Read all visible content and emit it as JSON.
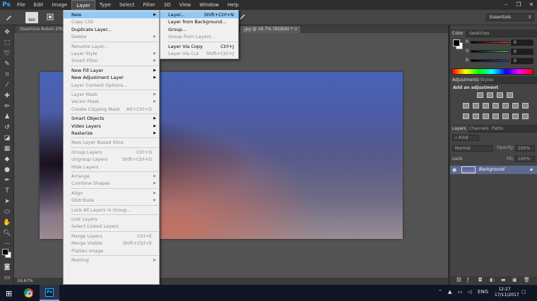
{
  "app": {
    "logo": "Ps"
  },
  "menubar": [
    "File",
    "Edit",
    "Image",
    "Layer",
    "Type",
    "Select",
    "Filter",
    "3D",
    "View",
    "Window",
    "Help"
  ],
  "window_controls": {
    "minimize": "–",
    "restore": "❐",
    "close": "✕"
  },
  "options": {
    "brush_size": "990",
    "workspace": "Essentials"
  },
  "tabs": [
    {
      "label": "Steelnine Bokeh Effe"
    },
    {
      "label": ".jpg @ 16.7% (RGB/8) *"
    }
  ],
  "status": {
    "zoom": "16.67%"
  },
  "layer_menu": [
    {
      "label": "New",
      "arrow": true,
      "highlight": true
    },
    {
      "label": "Copy CSS",
      "disabled": true
    },
    {
      "label": "Duplicate Layer..."
    },
    {
      "label": "Delete",
      "arrow": true,
      "disabled": true
    },
    {
      "sep": true
    },
    {
      "label": "Rename Layer...",
      "disabled": true
    },
    {
      "label": "Layer Style",
      "arrow": true,
      "disabled": true
    },
    {
      "label": "Smart Filter",
      "arrow": true,
      "disabled": true
    },
    {
      "sep": true
    },
    {
      "label": "New Fill Layer",
      "arrow": true
    },
    {
      "label": "New Adjustment Layer",
      "arrow": true
    },
    {
      "label": "Layer Content Options...",
      "disabled": true
    },
    {
      "sep": true
    },
    {
      "label": "Layer Mask",
      "arrow": true,
      "disabled": true
    },
    {
      "label": "Vector Mask",
      "arrow": true,
      "disabled": true
    },
    {
      "label": "Create Clipping Mask",
      "shortcut": "Alt+Ctrl+G",
      "disabled": true
    },
    {
      "sep": true
    },
    {
      "label": "Smart Objects",
      "arrow": true
    },
    {
      "label": "Video Layers",
      "arrow": true
    },
    {
      "label": "Rasterize",
      "arrow": true
    },
    {
      "sep": true
    },
    {
      "label": "New Layer Based Slice",
      "disabled": true
    },
    {
      "sep": true
    },
    {
      "label": "Group Layers",
      "shortcut": "Ctrl+G",
      "disabled": true
    },
    {
      "label": "Ungroup Layers",
      "shortcut": "Shift+Ctrl+G",
      "disabled": true
    },
    {
      "label": "Hide Layers",
      "disabled": true
    },
    {
      "sep": true
    },
    {
      "label": "Arrange",
      "arrow": true,
      "disabled": true
    },
    {
      "label": "Combine Shapes",
      "arrow": true,
      "disabled": true
    },
    {
      "sep": true
    },
    {
      "label": "Align",
      "arrow": true,
      "disabled": true
    },
    {
      "label": "Distribute",
      "arrow": true,
      "disabled": true
    },
    {
      "sep": true
    },
    {
      "label": "Lock All Layers in Group...",
      "disabled": true
    },
    {
      "sep": true
    },
    {
      "label": "Link Layers",
      "disabled": true
    },
    {
      "label": "Select Linked Layers",
      "disabled": true
    },
    {
      "sep": true
    },
    {
      "label": "Merge Layers",
      "shortcut": "Ctrl+E",
      "disabled": true
    },
    {
      "label": "Merge Visible",
      "shortcut": "Shift+Ctrl+E",
      "disabled": true
    },
    {
      "label": "Flatten Image",
      "disabled": true
    },
    {
      "sep": true
    },
    {
      "label": "Matting",
      "arrow": true,
      "disabled": true
    }
  ],
  "new_submenu": [
    {
      "label": "Layer...",
      "shortcut": "Shift+Ctrl+N",
      "highlight": true
    },
    {
      "label": "Layer from Background..."
    },
    {
      "label": "Group..."
    },
    {
      "label": "Group from Layers...",
      "disabled": true
    },
    {
      "sep": true
    },
    {
      "label": "Layer Via Copy",
      "shortcut": "Ctrl+J"
    },
    {
      "label": "Layer Via Cut",
      "shortcut": "Shift+Ctrl+J",
      "disabled": true
    }
  ],
  "color_panel": {
    "tabs": [
      "Color",
      "Swatches"
    ],
    "sliders": [
      {
        "label": "R",
        "value": "0",
        "color": "#c0392b"
      },
      {
        "label": "G",
        "value": "0",
        "color": "#27ae60"
      },
      {
        "label": "B",
        "value": "0",
        "color": "#2c3e9e"
      }
    ]
  },
  "adjustments_panel": {
    "tabs": [
      "Adjustments",
      "Styles"
    ],
    "title": "Add an adjustment"
  },
  "layers_panel": {
    "tabs": [
      "Layers",
      "Channels",
      "Paths"
    ],
    "kind": "Kind",
    "blend_mode": "Normal",
    "opacity_label": "Opacity:",
    "opacity_value": "100%",
    "lock_label": "Lock:",
    "fill_label": "Fill:",
    "fill_value": "100%",
    "layer_name": "Background"
  },
  "taskbar": {
    "lang": "ENG",
    "time": "12:27",
    "date": "17/11/2017"
  }
}
